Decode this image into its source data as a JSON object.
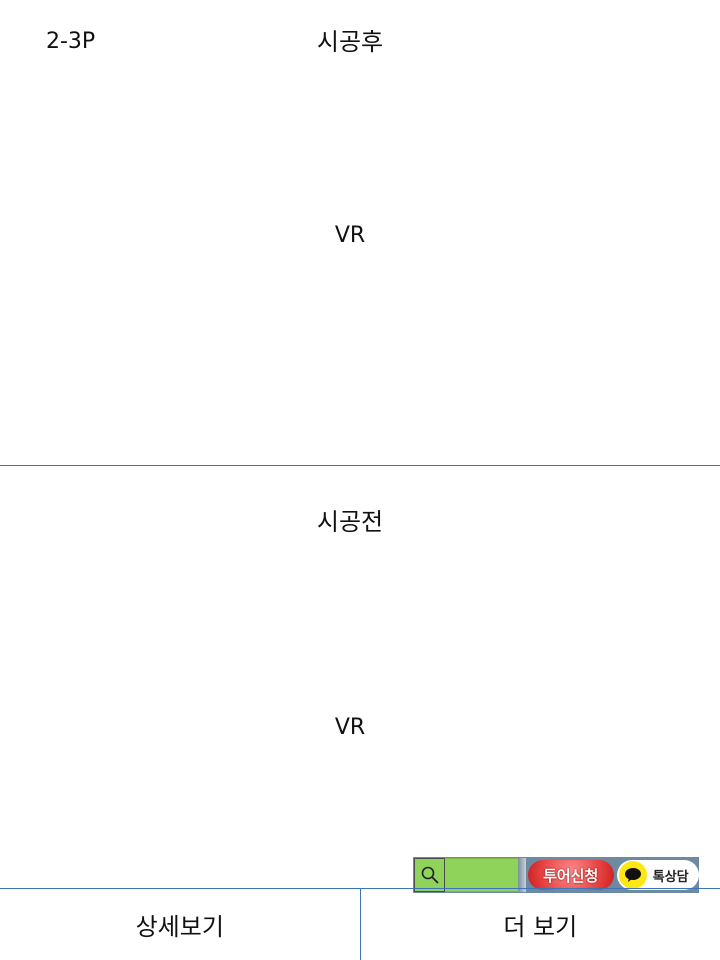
{
  "header": {
    "page_label": "2-3P"
  },
  "panels": {
    "after": {
      "title": "시공후",
      "vr_label": "VR"
    },
    "before": {
      "title": "시공전",
      "vr_label": "VR"
    }
  },
  "bottom_bar": {
    "detail_label": "상세보기",
    "more_label": "더 보기"
  },
  "widget": {
    "search_icon": "search-icon",
    "tour_label": "투어신청",
    "kakao_label": "톡상담",
    "kakao_icon": "chat-bubble-icon"
  },
  "colors": {
    "divider": "#3b74b8",
    "search_green": "#8fd35a",
    "tour_red": "#e33a3a",
    "kakao_yellow": "#ffe812"
  }
}
